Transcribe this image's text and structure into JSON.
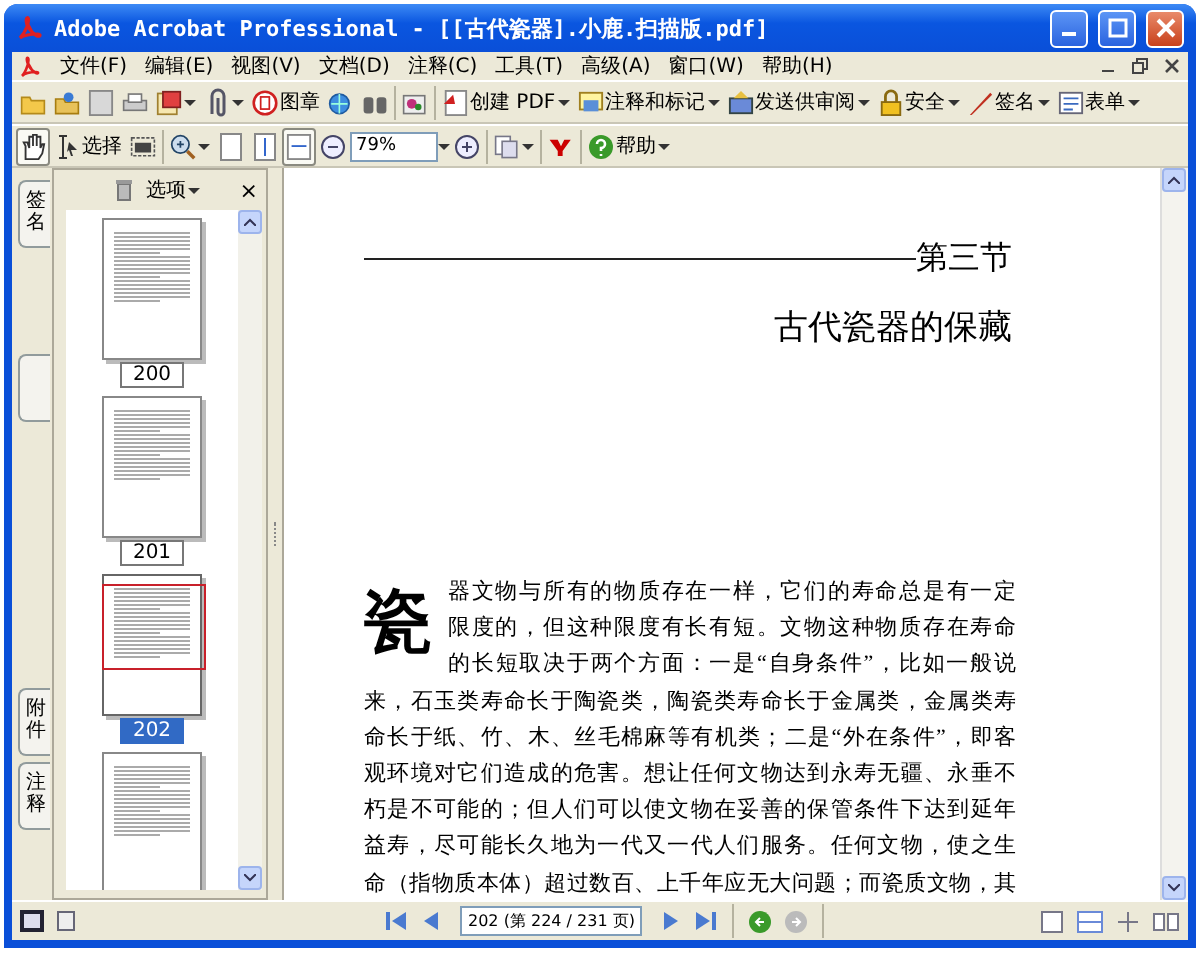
{
  "window": {
    "title": "Adobe Acrobat Professional - [[古代瓷器].小鹿.扫描版.pdf]"
  },
  "menu": [
    "文件(F)",
    "编辑(E)",
    "视图(V)",
    "文档(D)",
    "注释(C)",
    "工具(T)",
    "高级(A)",
    "窗口(W)",
    "帮助(H)"
  ],
  "toolbar_1": {
    "stamp_label": "图章",
    "task_buttons": [
      {
        "label": "创建 PDF"
      },
      {
        "label": "注释和标记"
      },
      {
        "label": "发送供审阅"
      },
      {
        "label": "安全"
      },
      {
        "label": "签名"
      },
      {
        "label": "表单"
      }
    ]
  },
  "toolbar_2": {
    "hand_tool": {
      "selected": true
    },
    "select_tool": {
      "label": "选择",
      "selected": false
    },
    "fit_width": {
      "selected": true
    },
    "zoom": "79%",
    "help": "帮助"
  },
  "side_tabs": [
    "签名",
    "附件",
    "注释"
  ],
  "nav_panel": {
    "options": "选项",
    "close": "×",
    "thumbnails": [
      {
        "label": "200",
        "selected": false
      },
      {
        "label": "201",
        "selected": false
      },
      {
        "label": "202",
        "selected": true
      },
      {
        "selected": false
      }
    ]
  },
  "document": {
    "section": "第三节",
    "title": "古代瓷器的保藏",
    "drop_cap": "瓷",
    "lines": [
      "器文物与所有的物质存在一样，它们的寿命总是有一定",
      "限度的，但这种限度有长有短。文物这种物质存在寿命",
      "的长短取决于两个方面：一是“自身条件”，比如一般说",
      "来，石玉类寿命长于陶瓷类，陶瓷类寿命长于金属类，金属类寿",
      "命长于纸、竹、木、丝毛棉麻等有机类；二是“外在条件”，即客",
      "观环境对它们造成的危害。想让任何文物达到永寿无疆、永垂不",
      "朽是不可能的；但人们可以使文物在妥善的保管条件下达到延年",
      "益寿，尽可能长久地为一代又一代人们服务。任何文物，使之生",
      "命（指物质本体）超过数百、上千年应无大问题；而瓷质文物，其"
    ]
  },
  "status_bar": {
    "page_field": "202 (第 224 / 231 页)"
  }
}
